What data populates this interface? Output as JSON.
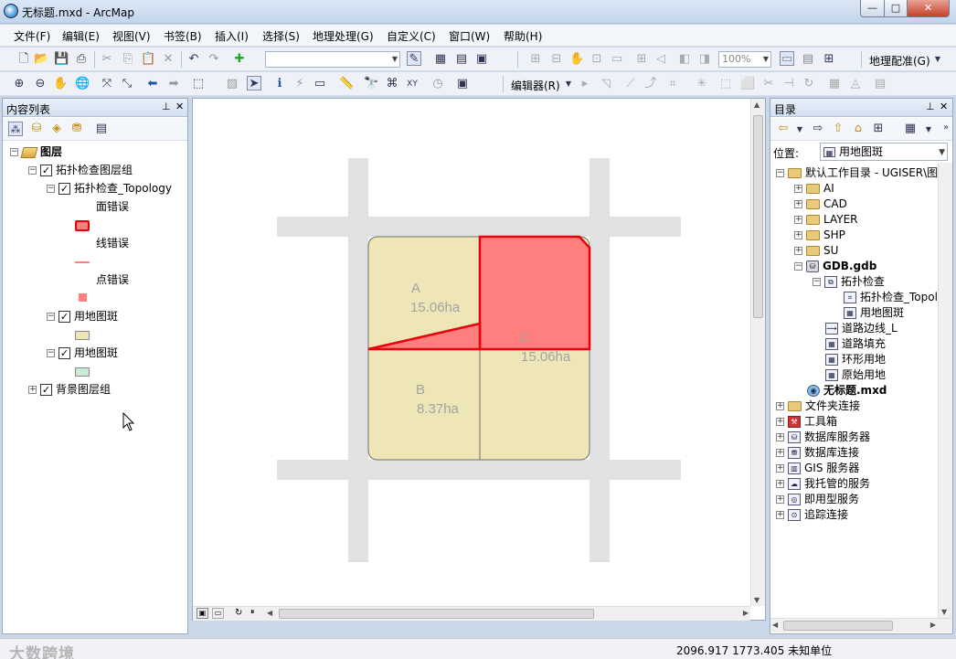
{
  "window": {
    "title": "无标题.mxd - ArcMap",
    "min": "—",
    "max": "□",
    "close": "✕"
  },
  "menu": [
    "文件(F)",
    "编辑(E)",
    "视图(V)",
    "书签(B)",
    "插入(I)",
    "选择(S)",
    "地理处理(G)",
    "自定义(C)",
    "窗口(W)",
    "帮助(H)"
  ],
  "toolbar": {
    "scale_value": "",
    "zoom_value": "100%",
    "georef_label": "地理配准(G)",
    "editor_label": "编辑器(R)"
  },
  "toc": {
    "title": "内容列表",
    "root": "图层",
    "items": [
      {
        "label": "拓扑检查图层组",
        "checked": true
      },
      {
        "label": "拓扑检查_Topology",
        "checked": true
      },
      {
        "label": "面错误"
      },
      {
        "label": "线错误"
      },
      {
        "label": "点错误"
      },
      {
        "label": "用地图斑",
        "checked": true
      },
      {
        "label": "用地图斑",
        "checked": true
      },
      {
        "label": "背景图层组",
        "checked": true
      }
    ]
  },
  "map": {
    "parcels": [
      {
        "name": "A",
        "area": "15.06ha"
      },
      {
        "name": "B",
        "area": "8.37ha"
      },
      {
        "name": "C",
        "area": "15.06ha"
      }
    ],
    "colors": {
      "parcel": "#efe6b8",
      "road": "#e1e1e1",
      "error": "#ff7f7f",
      "error_line": "#e8000b"
    }
  },
  "catalog": {
    "title": "目录",
    "location_label": "位置:",
    "location_value": "用地图斑",
    "items": [
      {
        "label": "默认工作目录 - UGISER\\图斑"
      },
      {
        "label": "AI"
      },
      {
        "label": "CAD"
      },
      {
        "label": "LAYER"
      },
      {
        "label": "SHP"
      },
      {
        "label": "SU"
      },
      {
        "label": "GDB.gdb"
      },
      {
        "label": "拓扑检查"
      },
      {
        "label": "拓扑检查_Topolc"
      },
      {
        "label": "用地图斑"
      },
      {
        "label": "道路边线_L"
      },
      {
        "label": "道路填充"
      },
      {
        "label": "环形用地"
      },
      {
        "label": "原始用地"
      },
      {
        "label": "无标题.mxd"
      },
      {
        "label": "文件夹连接"
      },
      {
        "label": "工具箱"
      },
      {
        "label": "数据库服务器"
      },
      {
        "label": "数据库连接"
      },
      {
        "label": "GIS 服务器"
      },
      {
        "label": "我托管的服务"
      },
      {
        "label": "即用型服务"
      },
      {
        "label": "追踪连接"
      }
    ]
  },
  "status": {
    "coords": "2096.917  1773.405 未知单位"
  },
  "watermark": "大数跨境"
}
